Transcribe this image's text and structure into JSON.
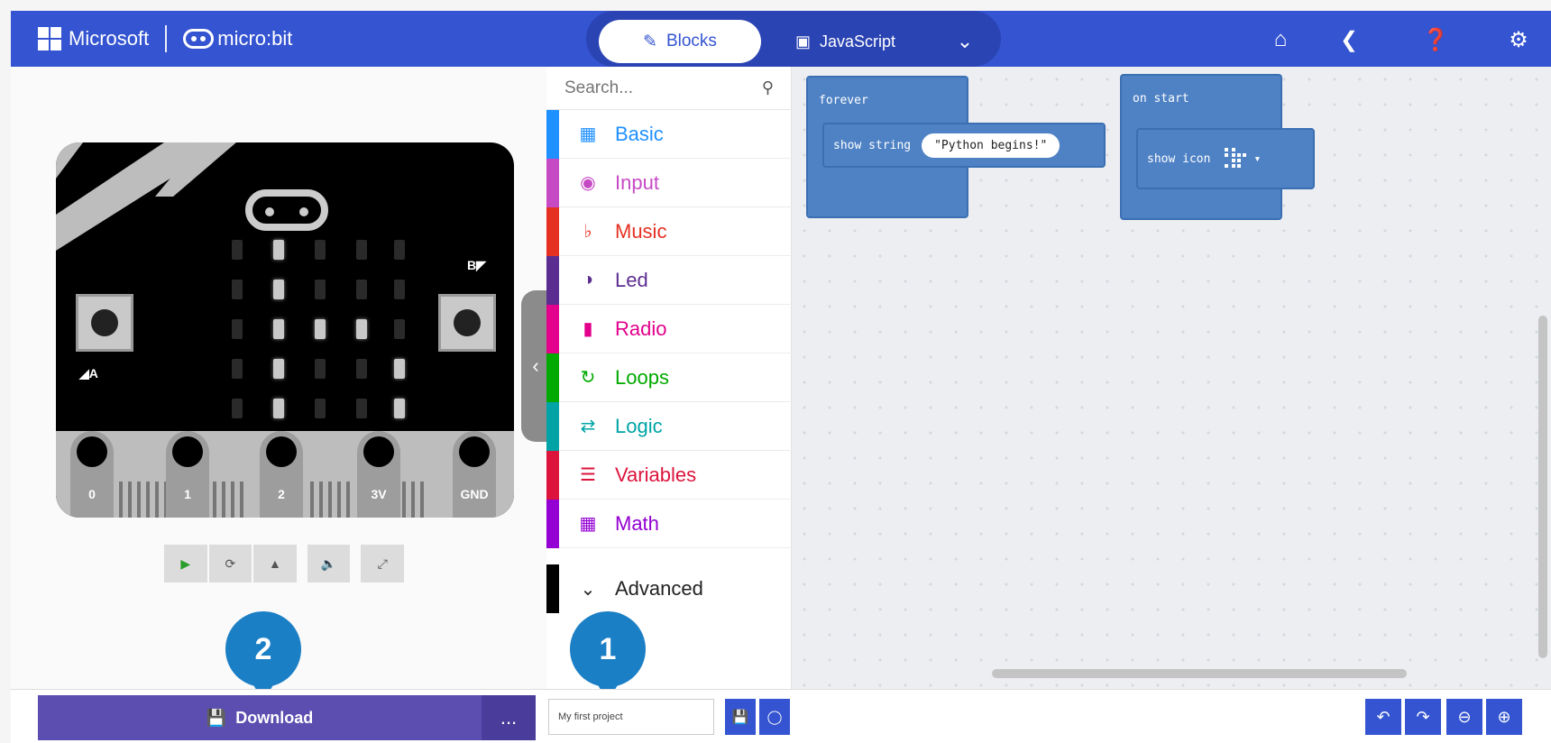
{
  "header": {
    "brand": "Microsoft",
    "product": "micro:bit",
    "tabs": [
      {
        "label": "Blocks",
        "active": true
      },
      {
        "label": "JavaScript",
        "active": false
      }
    ],
    "icons": [
      "home-icon",
      "share-icon",
      "help-icon",
      "settings-icon"
    ],
    "color": "#3454D1"
  },
  "simulator": {
    "button_a": "A",
    "button_b": "B",
    "pins": [
      "0",
      "1",
      "2",
      "3V",
      "GND"
    ],
    "controls": [
      "play-icon",
      "restart-icon",
      "debug-icon",
      "mute-icon",
      "fullscreen-icon"
    ]
  },
  "toolbox": {
    "search_placeholder": "Search...",
    "categories": [
      {
        "label": "Basic",
        "color": "#1e90ff"
      },
      {
        "label": "Input",
        "color": "#c64ac4"
      },
      {
        "label": "Music",
        "color": "#e63022"
      },
      {
        "label": "Led",
        "color": "#5c2d91"
      },
      {
        "label": "Radio",
        "color": "#e3008c"
      },
      {
        "label": "Loops",
        "color": "#00aa00"
      },
      {
        "label": "Logic",
        "color": "#00a4a6"
      },
      {
        "label": "Variables",
        "color": "#dc143c"
      },
      {
        "label": "Math",
        "color": "#9400d3"
      },
      {
        "label": "Advanced",
        "color": "#000000"
      }
    ]
  },
  "workspace": {
    "forever": {
      "title": "forever",
      "statement": "show string",
      "value": "\"Python begins!\""
    },
    "on_start": {
      "title": "on start",
      "statement": "show icon"
    }
  },
  "footer": {
    "download_label": "Download",
    "more_label": "...",
    "project_name": "My first project"
  },
  "callouts": [
    "1",
    "2"
  ]
}
